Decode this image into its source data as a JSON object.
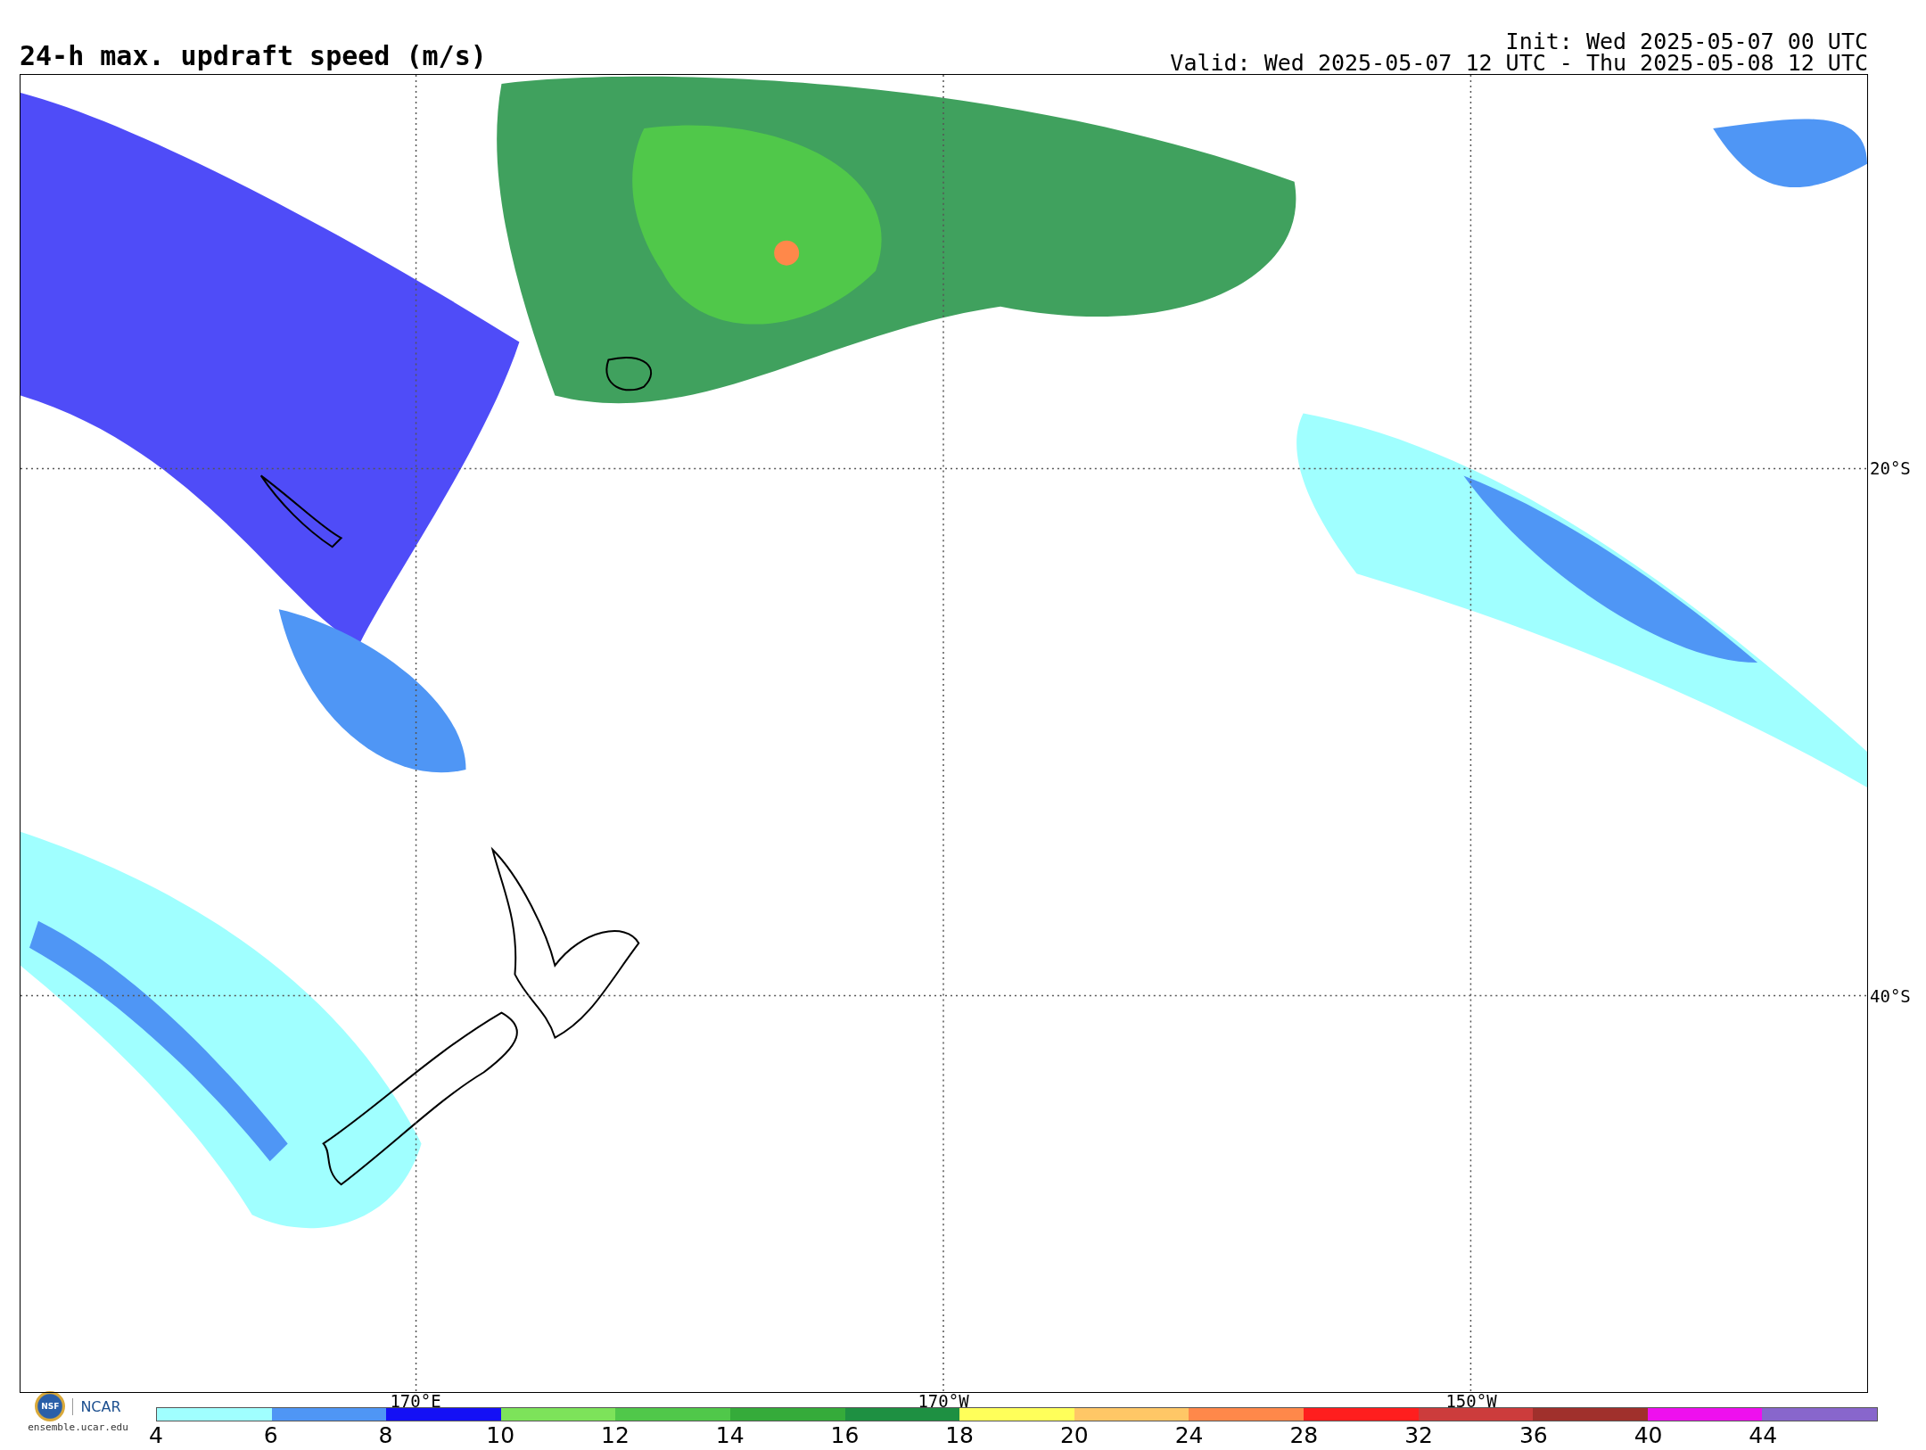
{
  "title": "24-h max. updraft speed (m/s)",
  "init": "Init: Wed 2025-05-07 00 UTC",
  "valid": "Valid: Wed 2025-05-07 12 UTC - Thu 2025-05-08 12 UTC",
  "map": {
    "latitude_labels": [
      "20°S",
      "40°S"
    ],
    "longitude_labels": [
      "170°E",
      "170°W",
      "150°W"
    ]
  },
  "logo": {
    "emblem": "NSF",
    "name": "NCAR",
    "url": "ensemble.ucar.edu"
  },
  "colorbar": {
    "bins": [
      {
        "label": "4",
        "color": "#a0ffff"
      },
      {
        "label": "6",
        "color": "#4f96f5"
      },
      {
        "label": "8",
        "color": "#1410f5"
      },
      {
        "label": "10",
        "color": "#7de35a"
      },
      {
        "label": "12",
        "color": "#50c84a"
      },
      {
        "label": "14",
        "color": "#35ab3a"
      },
      {
        "label": "16",
        "color": "#1e9042"
      },
      {
        "label": "18",
        "color": "#ffff5a"
      },
      {
        "label": "20",
        "color": "#ffc766"
      },
      {
        "label": "24",
        "color": "#ff884a"
      },
      {
        "label": "28",
        "color": "#ff1e1e"
      },
      {
        "label": "32",
        "color": "#cc3c3c"
      },
      {
        "label": "36",
        "color": "#a0302c"
      },
      {
        "label": "40",
        "color": "#ee10ee"
      },
      {
        "label": "44",
        "color": "#8866cc"
      }
    ]
  }
}
